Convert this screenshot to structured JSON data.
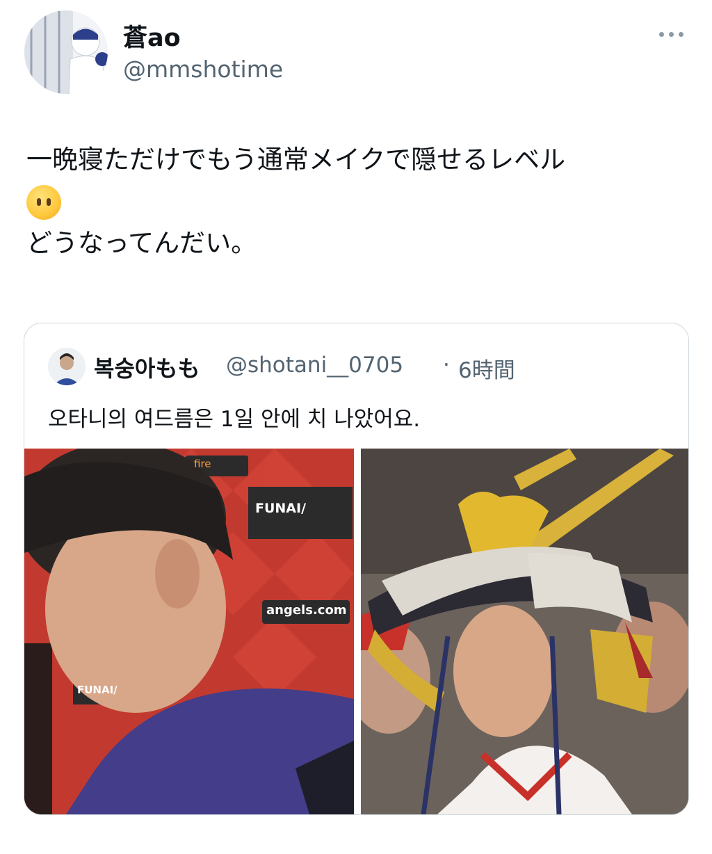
{
  "tweet": {
    "author": {
      "display_name": "蒼ao",
      "handle": "@mmshotime"
    },
    "lines": [
      "一晩寝ただけでもう通常メイクで隠せるレベル",
      "どうなってんだい。"
    ],
    "emoji": "face-without-mouth-emoji"
  },
  "quote": {
    "author": {
      "display_name": "복숭아もも",
      "handle": "@shotani__0705"
    },
    "separator": "·",
    "time": "6時間",
    "text": "오타니의 여드름은 1일 안에 치 나았어요.",
    "photos": [
      {
        "name": "close-up-photo",
        "signs": [
          "FUNAI/",
          "fire",
          "angels.com",
          "FUNAI/"
        ]
      },
      {
        "name": "kabuto-helmet-photo"
      }
    ]
  },
  "colors": {
    "text": "#0f1419",
    "secondary": "#536471",
    "border": "#cfd9de",
    "sign_red": "#c8312a"
  }
}
